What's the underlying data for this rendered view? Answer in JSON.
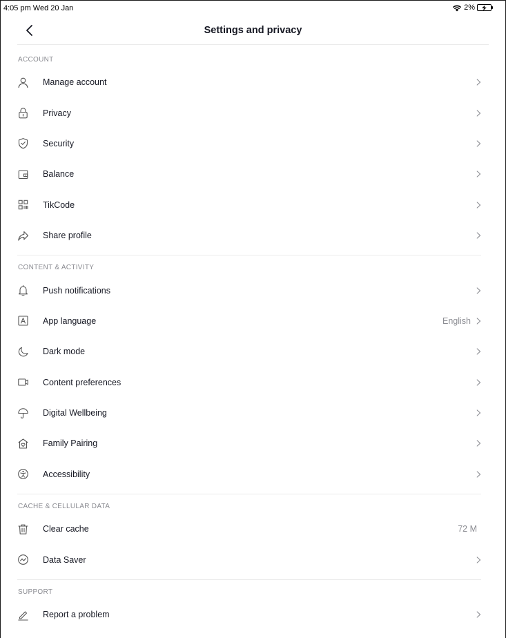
{
  "status_bar": {
    "time": "4:05 pm  Wed 20 Jan",
    "battery": "2%"
  },
  "header": {
    "title": "Settings and privacy"
  },
  "sections": [
    {
      "title": "ACCOUNT",
      "items": [
        {
          "label": "Manage account",
          "icon": "person-icon"
        },
        {
          "label": "Privacy",
          "icon": "lock-icon"
        },
        {
          "label": "Security",
          "icon": "shield-icon"
        },
        {
          "label": "Balance",
          "icon": "wallet-icon"
        },
        {
          "label": "TikCode",
          "icon": "qr-code-icon"
        },
        {
          "label": "Share profile",
          "icon": "share-icon"
        }
      ]
    },
    {
      "title": "CONTENT & ACTIVITY",
      "items": [
        {
          "label": "Push notifications",
          "icon": "bell-icon"
        },
        {
          "label": "App language",
          "icon": "language-icon",
          "value": "English"
        },
        {
          "label": "Dark mode",
          "icon": "moon-icon"
        },
        {
          "label": "Content preferences",
          "icon": "video-icon"
        },
        {
          "label": "Digital Wellbeing",
          "icon": "umbrella-icon"
        },
        {
          "label": "Family Pairing",
          "icon": "house-heart-icon"
        },
        {
          "label": "Accessibility",
          "icon": "accessibility-icon"
        }
      ]
    },
    {
      "title": "CACHE & CELLULAR DATA",
      "items": [
        {
          "label": "Clear cache",
          "icon": "trash-icon",
          "value": "72 M"
        },
        {
          "label": "Data Saver",
          "icon": "data-saver-icon"
        }
      ]
    },
    {
      "title": "SUPPORT",
      "items": [
        {
          "label": "Report a problem",
          "icon": "pencil-icon"
        }
      ]
    }
  ]
}
